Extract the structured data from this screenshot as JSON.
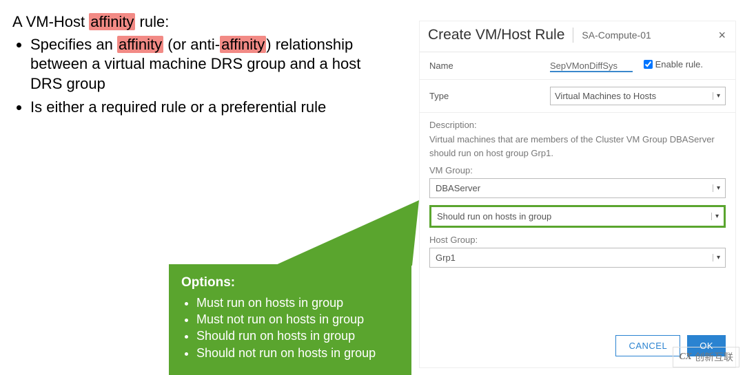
{
  "left": {
    "intro_prefix": "A VM-Host ",
    "intro_hl": "affinity",
    "intro_suffix": " rule:",
    "b1_prefix": "Specifies an ",
    "b1_hl1": "affinity",
    "b1_mid": " (or anti-",
    "b1_hl2": "affinity",
    "b1_suffix": ") relationship between a virtual machine DRS group and a host DRS group",
    "b2": "Is either a required rule or a preferential rule"
  },
  "dialog": {
    "title": "Create VM/Host Rule",
    "context": "SA-Compute-01",
    "name_label": "Name",
    "name_value": "SepVMonDiffSys",
    "enable_label": "Enable rule.",
    "type_label": "Type",
    "type_value": "Virtual Machines to Hosts",
    "desc_label": "Description:",
    "desc_text": "Virtual machines that are members of the Cluster VM Group DBAServer should run on host group Grp1.",
    "vmgroup_label": "VM Group:",
    "vmgroup_value": "DBAServer",
    "policy_value": "Should run on hosts in group",
    "hostgroup_label": "Host Group:",
    "hostgroup_value": "Grp1",
    "cancel": "CANCEL",
    "ok": "OK"
  },
  "tooltip": {
    "title": "Options:",
    "items": [
      "Must run on hosts in group",
      "Must not run on hosts in group",
      "Should run on hosts in group",
      "Should not run on hosts in group"
    ]
  },
  "watermark": {
    "logo": "CX",
    "text": "创新互联"
  }
}
